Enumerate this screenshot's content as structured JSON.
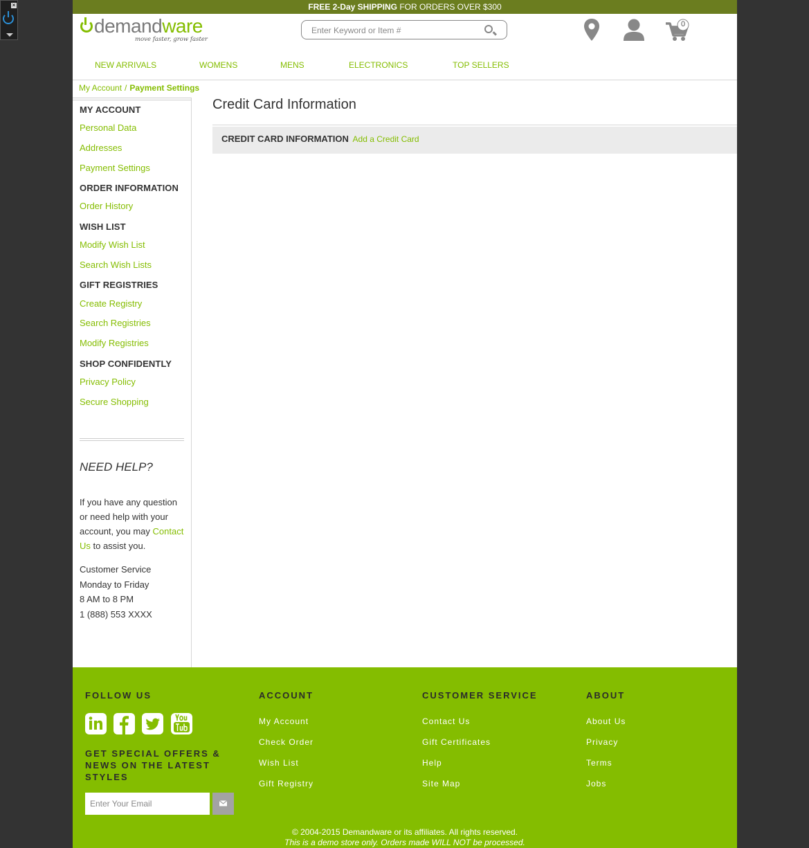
{
  "promo": {
    "bold": "FREE 2-Day SHIPPING",
    "rest": " FOR ORDERS OVER $300"
  },
  "logo": {
    "word_a": "demand",
    "word_b": "ware",
    "tagline": "move faster, grow faster"
  },
  "search": {
    "placeholder": "Enter Keyword or Item #"
  },
  "cart": {
    "count": "0"
  },
  "nav": [
    "NEW ARRIVALS",
    "WOMENS",
    "MENS",
    "ELECTRONICS",
    "TOP SELLERS"
  ],
  "breadcrumb": {
    "parent": "My Account",
    "separator": "/",
    "current": "Payment Settings"
  },
  "sidebar": {
    "my_account": {
      "title": "MY ACCOUNT",
      "links": [
        "Personal Data",
        "Addresses",
        "Payment Settings"
      ]
    },
    "order_info": {
      "title": "ORDER INFORMATION",
      "links": [
        "Order History"
      ]
    },
    "wish_list": {
      "title": "WISH LIST",
      "links": [
        "Modify Wish List",
        "Search Wish Lists"
      ]
    },
    "gift_registries": {
      "title": "GIFT REGISTRIES",
      "links": [
        "Create Registry",
        "Search Registries",
        "Modify Registries"
      ]
    },
    "shop_confidently": {
      "title": "SHOP CONFIDENTLY",
      "links": [
        "Privacy Policy",
        "Secure Shopping"
      ]
    },
    "need_help": {
      "title": "NEED HELP?",
      "text_before": "If you have any question or need help with your account, you may ",
      "link": "Contact Us",
      "text_after": " to assist you.",
      "service_lines": [
        "Customer Service",
        "Monday to Friday",
        "8 AM to 8 PM",
        "1 (888) 553 XXXX"
      ]
    }
  },
  "main": {
    "title": "Credit Card Information",
    "section_label": "CREDIT CARD INFORMATION",
    "add_link": "Add a Credit Card"
  },
  "footer": {
    "follow_title": "FOLLOW US",
    "social": [
      "linkedin-icon",
      "facebook-icon",
      "twitter-icon",
      "youtube-icon"
    ],
    "offers_title": "GET SPECIAL OFFERS & NEWS ON THE LATEST STYLES",
    "email_placeholder": "Enter Your Email",
    "account": {
      "title": "ACCOUNT",
      "links": [
        "My Account",
        "Check Order",
        "Wish List",
        "Gift Registry"
      ]
    },
    "customer_service": {
      "title": "CUSTOMER SERVICE",
      "links": [
        "Contact Us",
        "Gift Certificates",
        "Help",
        "Site Map"
      ]
    },
    "about": {
      "title": "ABOUT",
      "links": [
        "About Us",
        "Privacy",
        "Terms",
        "Jobs"
      ]
    },
    "copyright": "© 2004-2015 Demandware or its affiliates. All rights reserved.",
    "demo_note": "This is a demo store only. Orders made WILL NOT be processed."
  },
  "colors": {
    "brand_green": "#84bd00",
    "promo_bar": "#6b7d1f",
    "backdrop": "#333333"
  }
}
